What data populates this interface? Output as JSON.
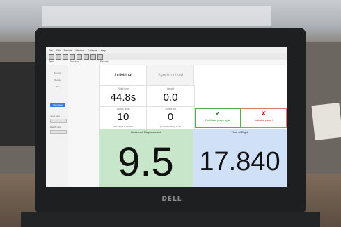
{
  "photo": {
    "laptop_brand": "DELL"
  },
  "app": {
    "menu": [
      "File",
      "Edit",
      "Results",
      "Window",
      "Calibrate",
      "Help"
    ],
    "tabs": [
      "Tests",
      "Sessions",
      "Results"
    ],
    "sidebar": {
      "items": [
        "Session",
        "Results",
        "Test",
        "Test name"
      ],
      "field_labels": [
        "Jump type",
        "Weight (kg)"
      ]
    },
    "modes": {
      "individual": "Individual",
      "synchronized": "Synchronized"
    },
    "stats": {
      "flight_time_label": "Flight time",
      "flight_time_value": "44.8s",
      "height_label": "Height",
      "height_value": "0.0",
      "jumps_label": "Jumps done",
      "jumps_value": "10",
      "jumps_sub": "total jumps in session",
      "jumps_left_label": "Jumps left",
      "jumps_left_value": "0",
      "jumps_left_sub": "jumps remaining in set"
    },
    "status": {
      "ok_icon": "✔",
      "ok_text": "Could take jumps again",
      "err_icon": "✘",
      "err_text": "Indicates press 1"
    },
    "displacement": {
      "title": "Horizontal Displacement",
      "value": "9.5"
    },
    "time_of_flight": {
      "title": "Time of Flight",
      "value": "17.840"
    },
    "colors": {
      "displacement_bg": "#c8e6c9",
      "tof_bg": "#cfe0f7",
      "accent": "#3b78d8",
      "ok": "#2e7d32",
      "error": "#c62828"
    }
  }
}
